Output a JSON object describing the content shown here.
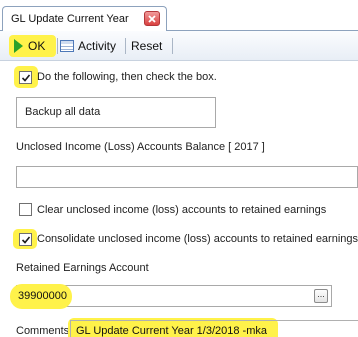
{
  "tab": {
    "title": "GL Update Current Year"
  },
  "toolbar": {
    "ok_label": "OK",
    "activity_label": "Activity",
    "reset_label": "Reset"
  },
  "form": {
    "instruction_label": "Do the following, then check the box.",
    "instruction_checked": true,
    "task_text": "Backup all data",
    "unclosed_balance_label": "Unclosed Income (Loss) Accounts Balance [ 2017 ]",
    "unclosed_balance_value": "",
    "clear_label": "Clear unclosed income (loss) accounts to retained earnings",
    "clear_checked": false,
    "consolidate_label": "Consolidate unclosed income (loss) accounts to retained earnings",
    "consolidate_checked": true,
    "retained_label": "Retained Earnings Account",
    "retained_value": "39900000",
    "lookup_label": "...",
    "comments_label": "Comments",
    "comments_value": "GL Update Current Year 1/3/2018 -mka"
  },
  "colors": {
    "highlight": "#fff24a",
    "ok_arrow": "#2aa12a",
    "close_button": "#d9413f"
  }
}
